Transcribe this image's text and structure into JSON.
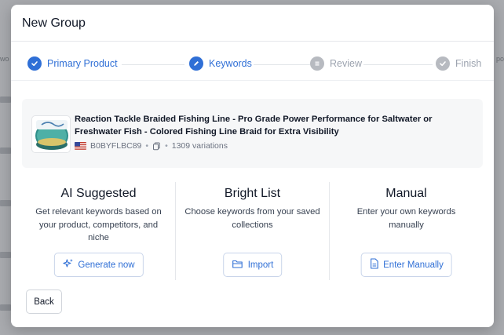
{
  "modal": {
    "title": "New Group"
  },
  "steps": [
    {
      "label": "Primary Product",
      "state": "done",
      "icon": "check-icon"
    },
    {
      "label": "Keywords",
      "state": "active",
      "icon": "pencil-icon"
    },
    {
      "label": "Review",
      "state": "upcoming",
      "icon": "list-icon"
    },
    {
      "label": "Finish",
      "state": "upcoming",
      "icon": "check-icon"
    }
  ],
  "product": {
    "title": "Reaction Tackle Braided Fishing Line - Pro Grade Power Performance for Saltwater or Freshwater Fish - Colored Fishing Line Braid for Extra Visibility",
    "asin": "B0BYFLBC89",
    "variations": "1309 variations",
    "marketplace_icon": "us-flag-icon",
    "separator": "•"
  },
  "options": [
    {
      "title": "AI Suggested",
      "description": "Get relevant keywords based on your product, competitors, and niche",
      "button_label": "Generate now",
      "button_icon": "sparkles-icon"
    },
    {
      "title": "Bright List",
      "description": "Choose keywords from your saved collections",
      "button_label": "Import",
      "button_icon": "folder-icon"
    },
    {
      "title": "Manual",
      "description": "Enter your own keywords manually",
      "button_label": "Enter Manually",
      "button_icon": "document-icon"
    }
  ],
  "footer": {
    "back_label": "Back"
  },
  "colors": {
    "accent": "#2f6fd6",
    "muted": "#b7bac0",
    "text": "#111827",
    "subtle_bg": "#f6f7f8"
  }
}
